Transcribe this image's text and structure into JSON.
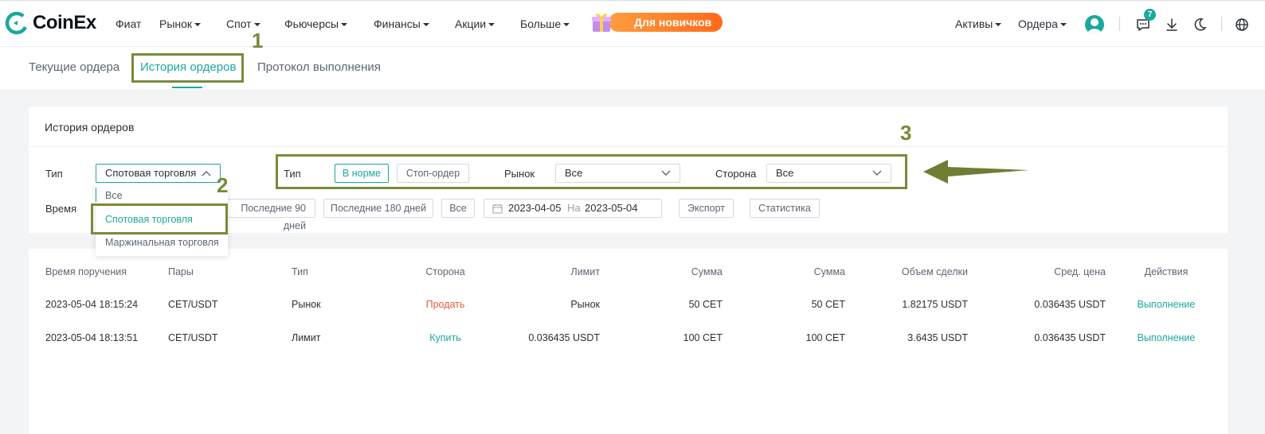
{
  "brand": {
    "name": "CoinEx"
  },
  "nav": {
    "items": [
      "Фиат",
      "Рынок",
      "Спот",
      "Фьючерсы",
      "Финансы",
      "Акции",
      "Больше"
    ],
    "promo_label": "Для новичков",
    "assets": "Активы",
    "orders": "Ордера",
    "notification_count": "7"
  },
  "subtabs": [
    "Текущие ордера",
    "История ордеров",
    "Протокол выполнения"
  ],
  "filters": {
    "title": "История ордеров",
    "type_label": "Тип",
    "type_value": "Спотовая торговля",
    "type_options": [
      "Все",
      "Спотовая торговля",
      "Маржинальная торговля"
    ],
    "order_type_label": "Тип",
    "order_type_normal": "В норме",
    "order_type_stop": "Стоп-ордер",
    "market_label": "Рынок",
    "market_value": "Все",
    "side_label": "Сторона",
    "side_value": "Все",
    "time_label": "Время",
    "range_90": "Последние 90 дней",
    "range_180": "Последние 180 дней",
    "range_all": "Все",
    "date_from": "2023-04-05",
    "date_sep": "На",
    "date_to": "2023-05-04",
    "export": "Экспорт",
    "stats": "Статистика"
  },
  "table": {
    "headers": [
      "Время поручения",
      "Пары",
      "Тип",
      "Сторона",
      "Лимит",
      "Сумма",
      "Сумма",
      "Объем сделки",
      "Сред. цена",
      "Действия"
    ],
    "rows": [
      [
        "2023-05-04 18:15:24",
        "CET/USDT",
        "Рынок",
        "Продать",
        "Рынок",
        "50 CET",
        "50 CET",
        "1.82175 USDT",
        "0.036435 USDT",
        "Выполнение"
      ],
      [
        "2023-05-04 18:13:51",
        "CET/USDT",
        "Лимит",
        "Купить",
        "0.036435 USDT",
        "100 CET",
        "100 CET",
        "3.6435 USDT",
        "0.036435 USDT",
        "Выполнение"
      ]
    ]
  },
  "annotations": [
    "1",
    "2",
    "3"
  ],
  "colors": {
    "accent": "#1aa99c",
    "sell": "#e8573b",
    "annotation": "#7a8a3a",
    "promo": "#ff7a22"
  }
}
